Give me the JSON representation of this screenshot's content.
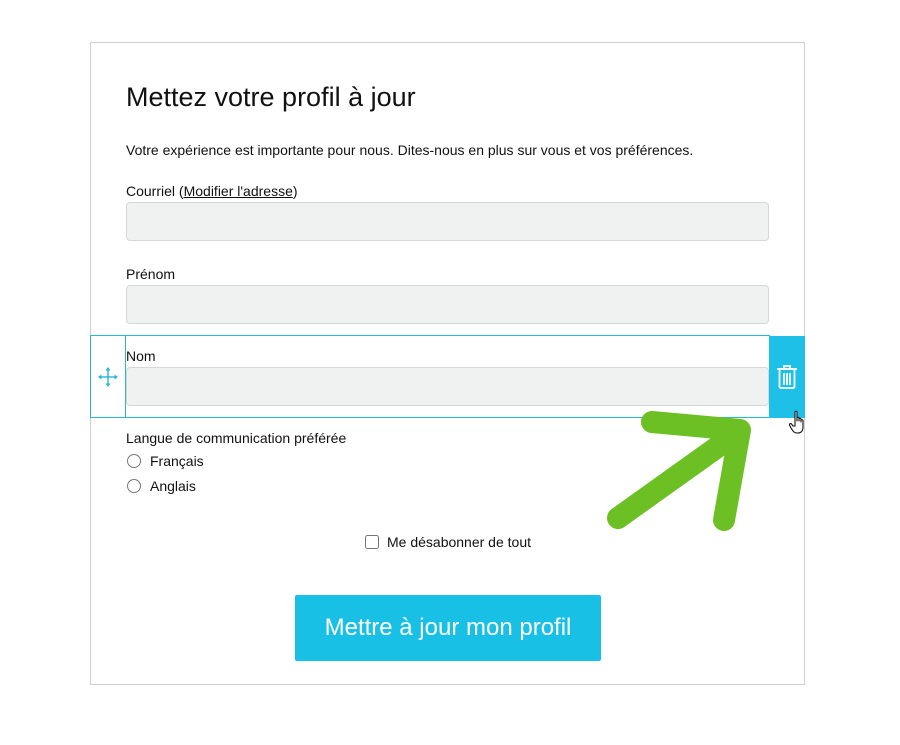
{
  "form": {
    "title": "Mettez votre profil à jour",
    "intro": "Votre expérience est importante pour nous. Dites-nous en plus sur vous et vos préférences.",
    "email": {
      "label_prefix": "Courriel (",
      "link_text": "Modifier l'adresse",
      "label_suffix": ")",
      "value": ""
    },
    "firstname": {
      "label": "Prénom",
      "value": ""
    },
    "lastname": {
      "label": "Nom",
      "value": ""
    },
    "language": {
      "label": "Langue de communication préférée",
      "options": [
        "Français",
        "Anglais"
      ]
    },
    "unsubscribe_label": "Me désabonner de tout",
    "submit_label": "Mettre à jour mon profil"
  },
  "editor": {
    "move_icon": "move-arrows-icon",
    "delete_icon": "trash-icon",
    "accent_color": "#1ec0e8",
    "annotation_color": "#6cc024"
  }
}
